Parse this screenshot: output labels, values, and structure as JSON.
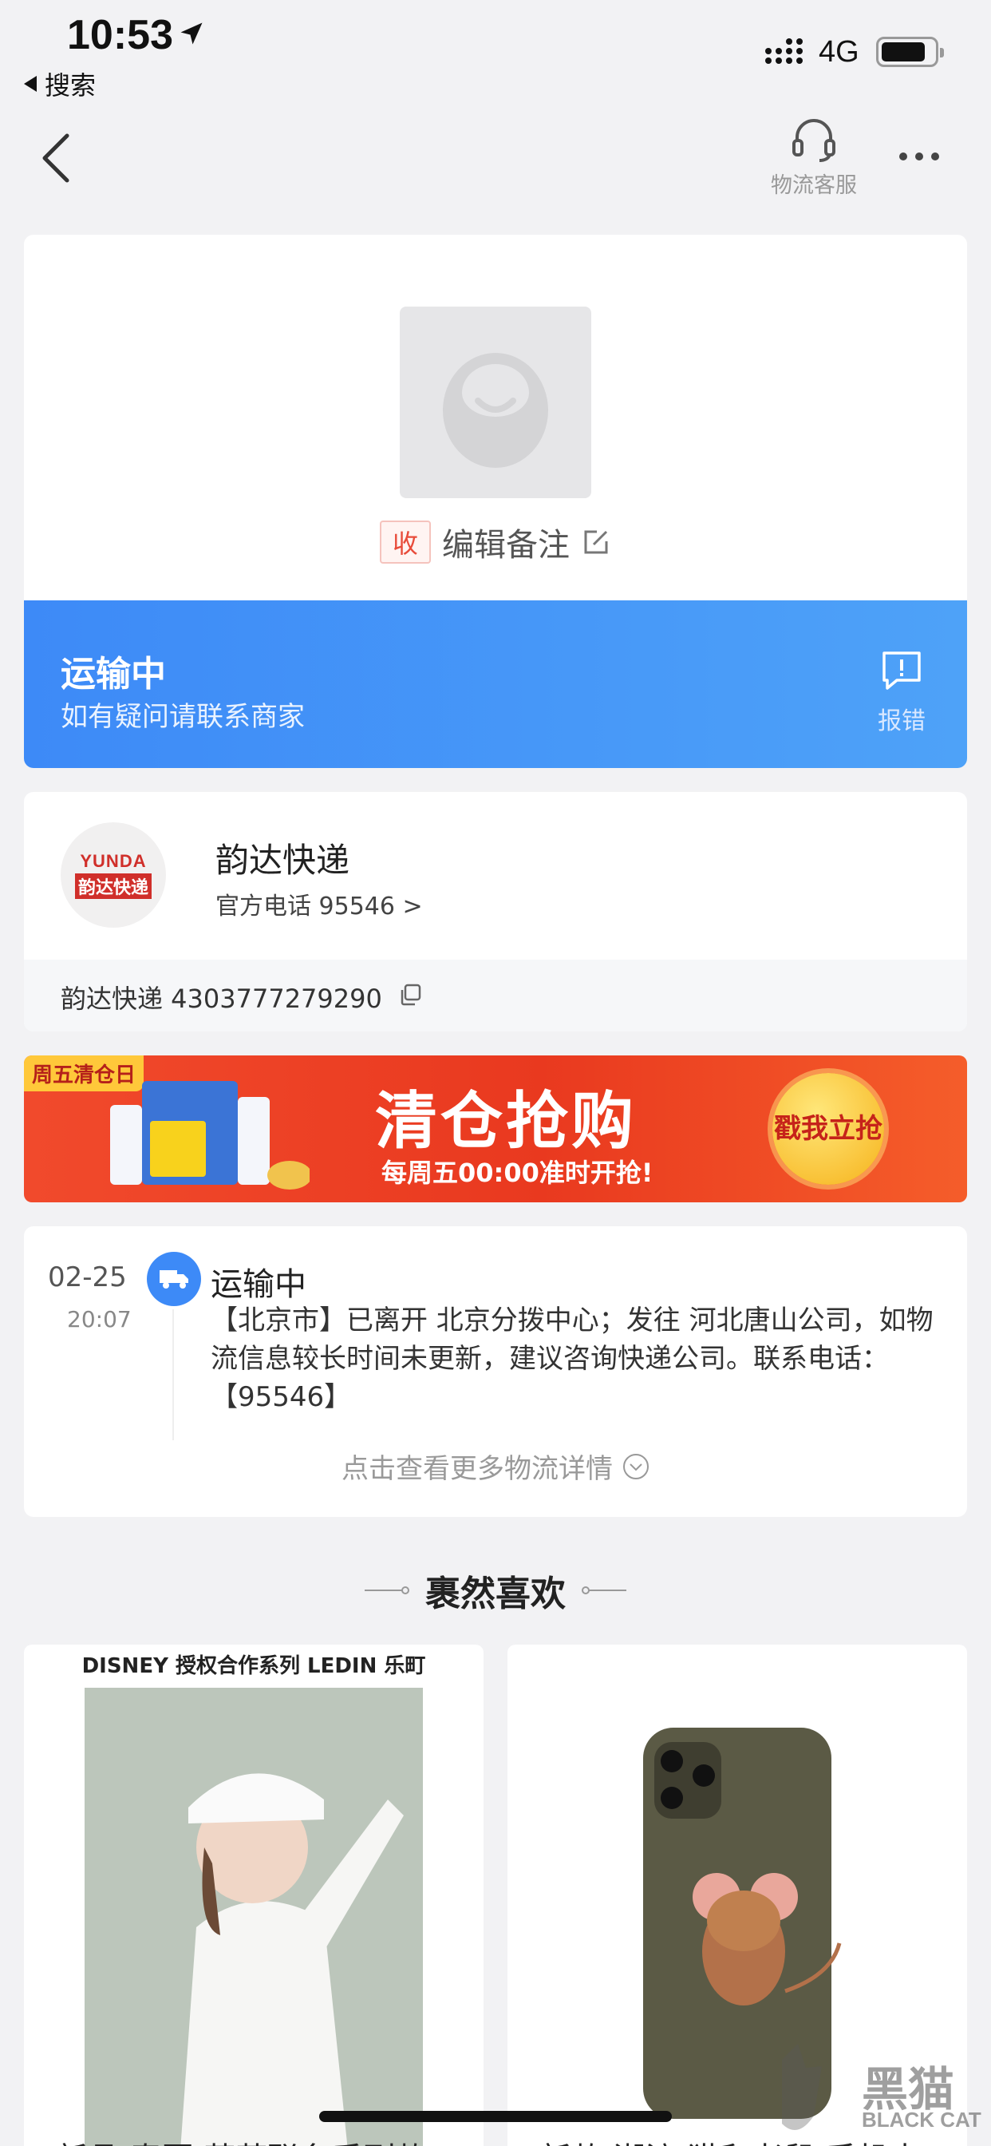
{
  "status_bar": {
    "time": "10:53",
    "back_app": "搜索",
    "network": "4G"
  },
  "nav": {
    "customer_service_label": "物流客服"
  },
  "package": {
    "receive_tag": "收",
    "note_label": "编辑备注"
  },
  "transit": {
    "title": "运输中",
    "subtitle": "如有疑问请联系商家",
    "report_label": "报错"
  },
  "courier": {
    "logo_en": "YUNDA",
    "logo_cn": "韵达快递",
    "name": "韵达快递",
    "phone": "官方电话 95546 >",
    "tracking": "韵达快递 4303777279290"
  },
  "promo": {
    "tag": "周五清仓日",
    "title": "清仓抢购",
    "subtitle": "每周五00:00准时开抢!",
    "button": "戳我立抢"
  },
  "timeline": {
    "date": "02-25",
    "time": "20:07",
    "status": "运输中",
    "detail": "【北京市】已离开 北京分拨中心；发往 河北唐山公司，如物流信息较长时间未更新，建议咨询快递公司。联系电话：【95546】",
    "more": "点击查看更多物流详情"
  },
  "recommend": {
    "title": "裹然喜欢",
    "items": [
      {
        "brand": "DISNEY 授权合作系列 LEDIN 乐町",
        "caption": "新品 春夏 萌萌联名系列款"
      },
      {
        "brand": "",
        "caption": "新款 潮流 猫和老鼠 手机壳"
      }
    ]
  },
  "watermark": {
    "text": "黑猫",
    "sub": "BLACK CAT"
  },
  "colors": {
    "accent_blue": "#3d8af7",
    "promo_red": "#e9391f",
    "tag_red": "#e84b3a"
  }
}
